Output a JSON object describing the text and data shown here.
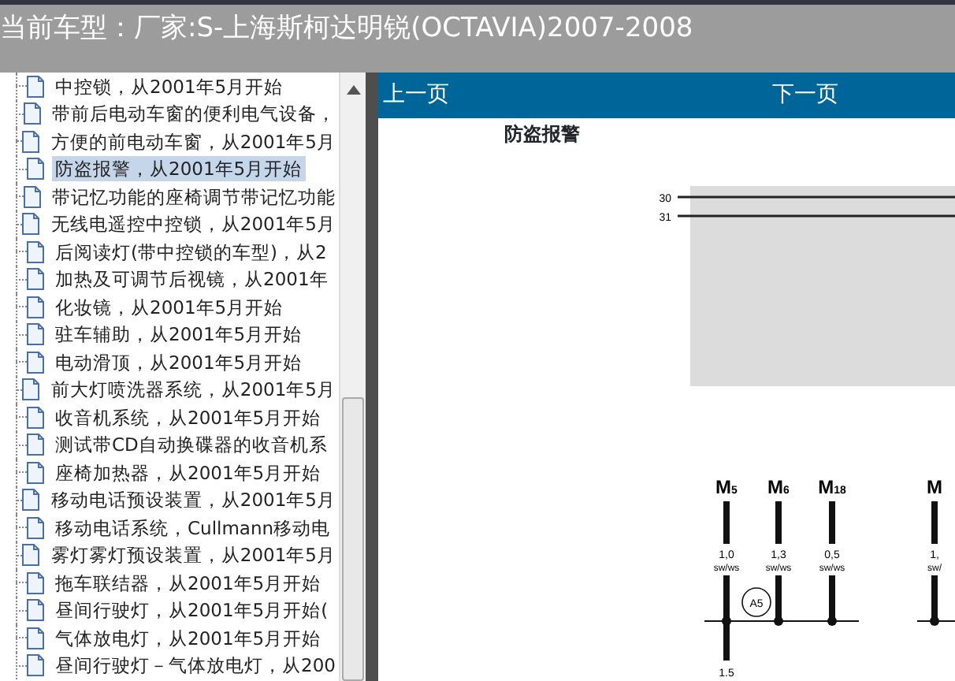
{
  "window": {
    "title": "当前车型：厂家:S-上海斯柯达明锐(OCTAVIA)2007-2008"
  },
  "tree": {
    "items": [
      {
        "label": "中控锁，从2001年5月开始",
        "selected": false
      },
      {
        "label": "带前后电动车窗的便利电气设备，",
        "selected": false
      },
      {
        "label": "方便的前电动车窗，从2001年5月",
        "selected": false
      },
      {
        "label": "防盗报警，从2001年5月开始",
        "selected": true
      },
      {
        "label": "带记忆功能的座椅调节带记忆功能",
        "selected": false
      },
      {
        "label": "无线电遥控中控锁，从2001年5月",
        "selected": false
      },
      {
        "label": "后阅读灯(带中控锁的车型)，从2",
        "selected": false
      },
      {
        "label": "加热及可调节后视镜，从2001年",
        "selected": false
      },
      {
        "label": "化妆镜，从2001年5月开始",
        "selected": false
      },
      {
        "label": "驻车辅助，从2001年5月开始",
        "selected": false
      },
      {
        "label": "电动滑顶，从2001年5月开始",
        "selected": false
      },
      {
        "label": "前大灯喷洗器系统，从2001年5月",
        "selected": false
      },
      {
        "label": "收音机系统，从2001年5月开始",
        "selected": false
      },
      {
        "label": "测试带CD自动换碟器的收音机系",
        "selected": false
      },
      {
        "label": "座椅加热器，从2001年5月开始",
        "selected": false
      },
      {
        "label": "移动电话预设装置，从2001年5月",
        "selected": false
      },
      {
        "label": "移动电话系统，Cullmann移动电",
        "selected": false
      },
      {
        "label": "雾灯雾灯预设装置，从2001年5月",
        "selected": false
      },
      {
        "label": "拖车联结器，从2001年5月开始",
        "selected": false
      },
      {
        "label": "昼间行驶灯，从2001年5月开始(",
        "selected": false
      },
      {
        "label": "气体放电灯，从2001年5月开始",
        "selected": false
      },
      {
        "label": "昼间行驶灯－气体放电灯，从200",
        "selected": false
      }
    ]
  },
  "viewer": {
    "toolbar": {
      "previous": "上一页",
      "next": "下一页"
    },
    "document": {
      "heading": "防盗报警",
      "diagram": {
        "rails": [
          "30",
          "31"
        ],
        "connectors": [
          {
            "label": "M$_{5}$",
            "section": "1,0",
            "wire": "sw/ws",
            "below": "1.5"
          },
          {
            "label": "M$_{6}$",
            "section": "1,3",
            "wire": "sw/ws"
          },
          {
            "label": "M$_{18}$",
            "section": "0,5",
            "wire": "sw/ws"
          },
          {
            "label": "M",
            "section": "1,",
            "wire": "sw/"
          }
        ],
        "marker": "A5"
      }
    }
  }
}
